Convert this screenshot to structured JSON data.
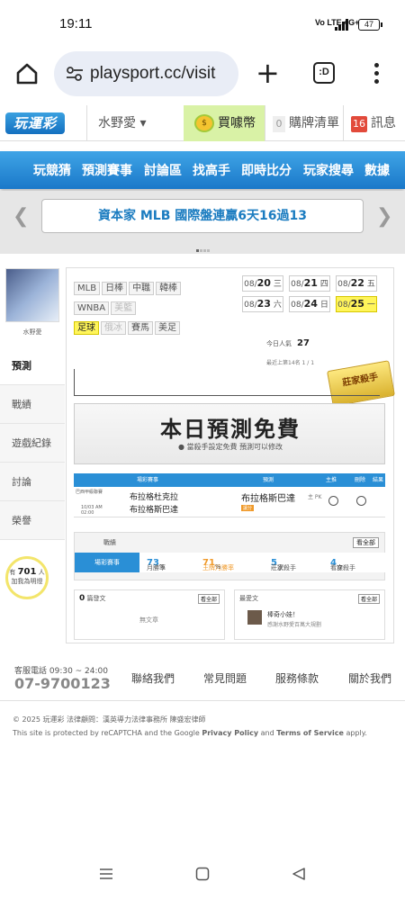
{
  "status": {
    "time": "19:11",
    "network": "Vo LTE 4G+",
    "battery": "47"
  },
  "browser": {
    "url": "playsport.cc/visit",
    "tabs_label": ":D"
  },
  "site": {
    "logo": "玩運彩",
    "user": "水野愛",
    "buy_coin": "買噱幣",
    "cart_label": "購牌清單",
    "cart_count": "0",
    "msg_label": "訊息",
    "msg_count": "16"
  },
  "nav": [
    "玩競猜",
    "預測賽事",
    "討論區",
    "找高手",
    "即時比分",
    "玩家搜尋",
    "數據"
  ],
  "banner": {
    "text": "資本家 MLB 國際盤連贏6天16過13"
  },
  "sidebar": {
    "name": "水野愛",
    "menu": [
      "預測",
      "戰績",
      "遊戲紀錄",
      "討論",
      "榮譽"
    ],
    "bulb_prefix": "有",
    "bulb_count": "701",
    "bulb_suffix": "人",
    "bulb_line2": "加我為明燈"
  },
  "tags": {
    "row1": [
      "MLB",
      "日棒",
      "中職",
      "韓棒"
    ],
    "row2": [
      "WNBA",
      "美籃"
    ],
    "row3": [
      "足球",
      "俄冰",
      "賽馬",
      "美足"
    ]
  },
  "dates": [
    {
      "d": "08/",
      "n": "20",
      "w": "三"
    },
    {
      "d": "08/",
      "n": "21",
      "w": "四"
    },
    {
      "d": "08/",
      "n": "22",
      "w": "五"
    },
    {
      "d": "08/",
      "n": "23",
      "w": "六"
    },
    {
      "d": "08/",
      "n": "24",
      "w": "日"
    },
    {
      "d": "08/",
      "n": "25",
      "w": "一"
    }
  ],
  "popularity": {
    "label": "今日人氣",
    "value": "27"
  },
  "rank_text": "最近上第14名 1 / 1",
  "gold_badge": "莊家殺手",
  "free": {
    "title": "本日預測免費",
    "sub": "當殺手設定免費 預測可以修改"
  },
  "pred_table": {
    "headers": [
      "場彩賽事",
      "預測",
      "主推",
      "刪除",
      "結果"
    ],
    "league": "巴西甲級聯賽",
    "time": "10/03 AM 02:00",
    "team1": "布拉格杜克拉",
    "team2": "布拉格斯巴達",
    "pick": "布拉格斯巴達",
    "pick_side": "主 PK",
    "pick_tag": "讓分"
  },
  "stats": {
    "title": "戰績",
    "all": "看全部",
    "tab": "場彩賽事",
    "items": [
      {
        "label": "月勝率",
        "value": "73",
        "unit": "%"
      },
      {
        "label": "王牌月勝率",
        "value": "71",
        "unit": "%"
      },
      {
        "label": "莊家殺手",
        "value": "5",
        "unit": "次"
      },
      {
        "label": "看穿殺手",
        "value": "4",
        "unit": "次"
      }
    ]
  },
  "left_half": {
    "count": "0",
    "title": "篇發文",
    "all": "看全部",
    "empty": "無文章"
  },
  "right_half": {
    "title": "最愛文",
    "all": "看全部",
    "user": "棒奇小娃！",
    "desc": "感謝水野愛百萬大規劃"
  },
  "footer": {
    "service": "客服電話 09:30 ~ 24:00",
    "phone": "07-9700123",
    "links": [
      "聯絡我們",
      "常見問題",
      "服務條款",
      "關於我們"
    ],
    "copyright": "© 2025 玩運彩 法律顧問：漢英導力法律事務所 陳盛宏律師",
    "recap_pre": "This site is protected by reCAPTCHA and the Google ",
    "recap_pp": "Privacy Policy",
    "recap_and": " and ",
    "recap_tos": "Terms of Service",
    "recap_post": " apply."
  }
}
